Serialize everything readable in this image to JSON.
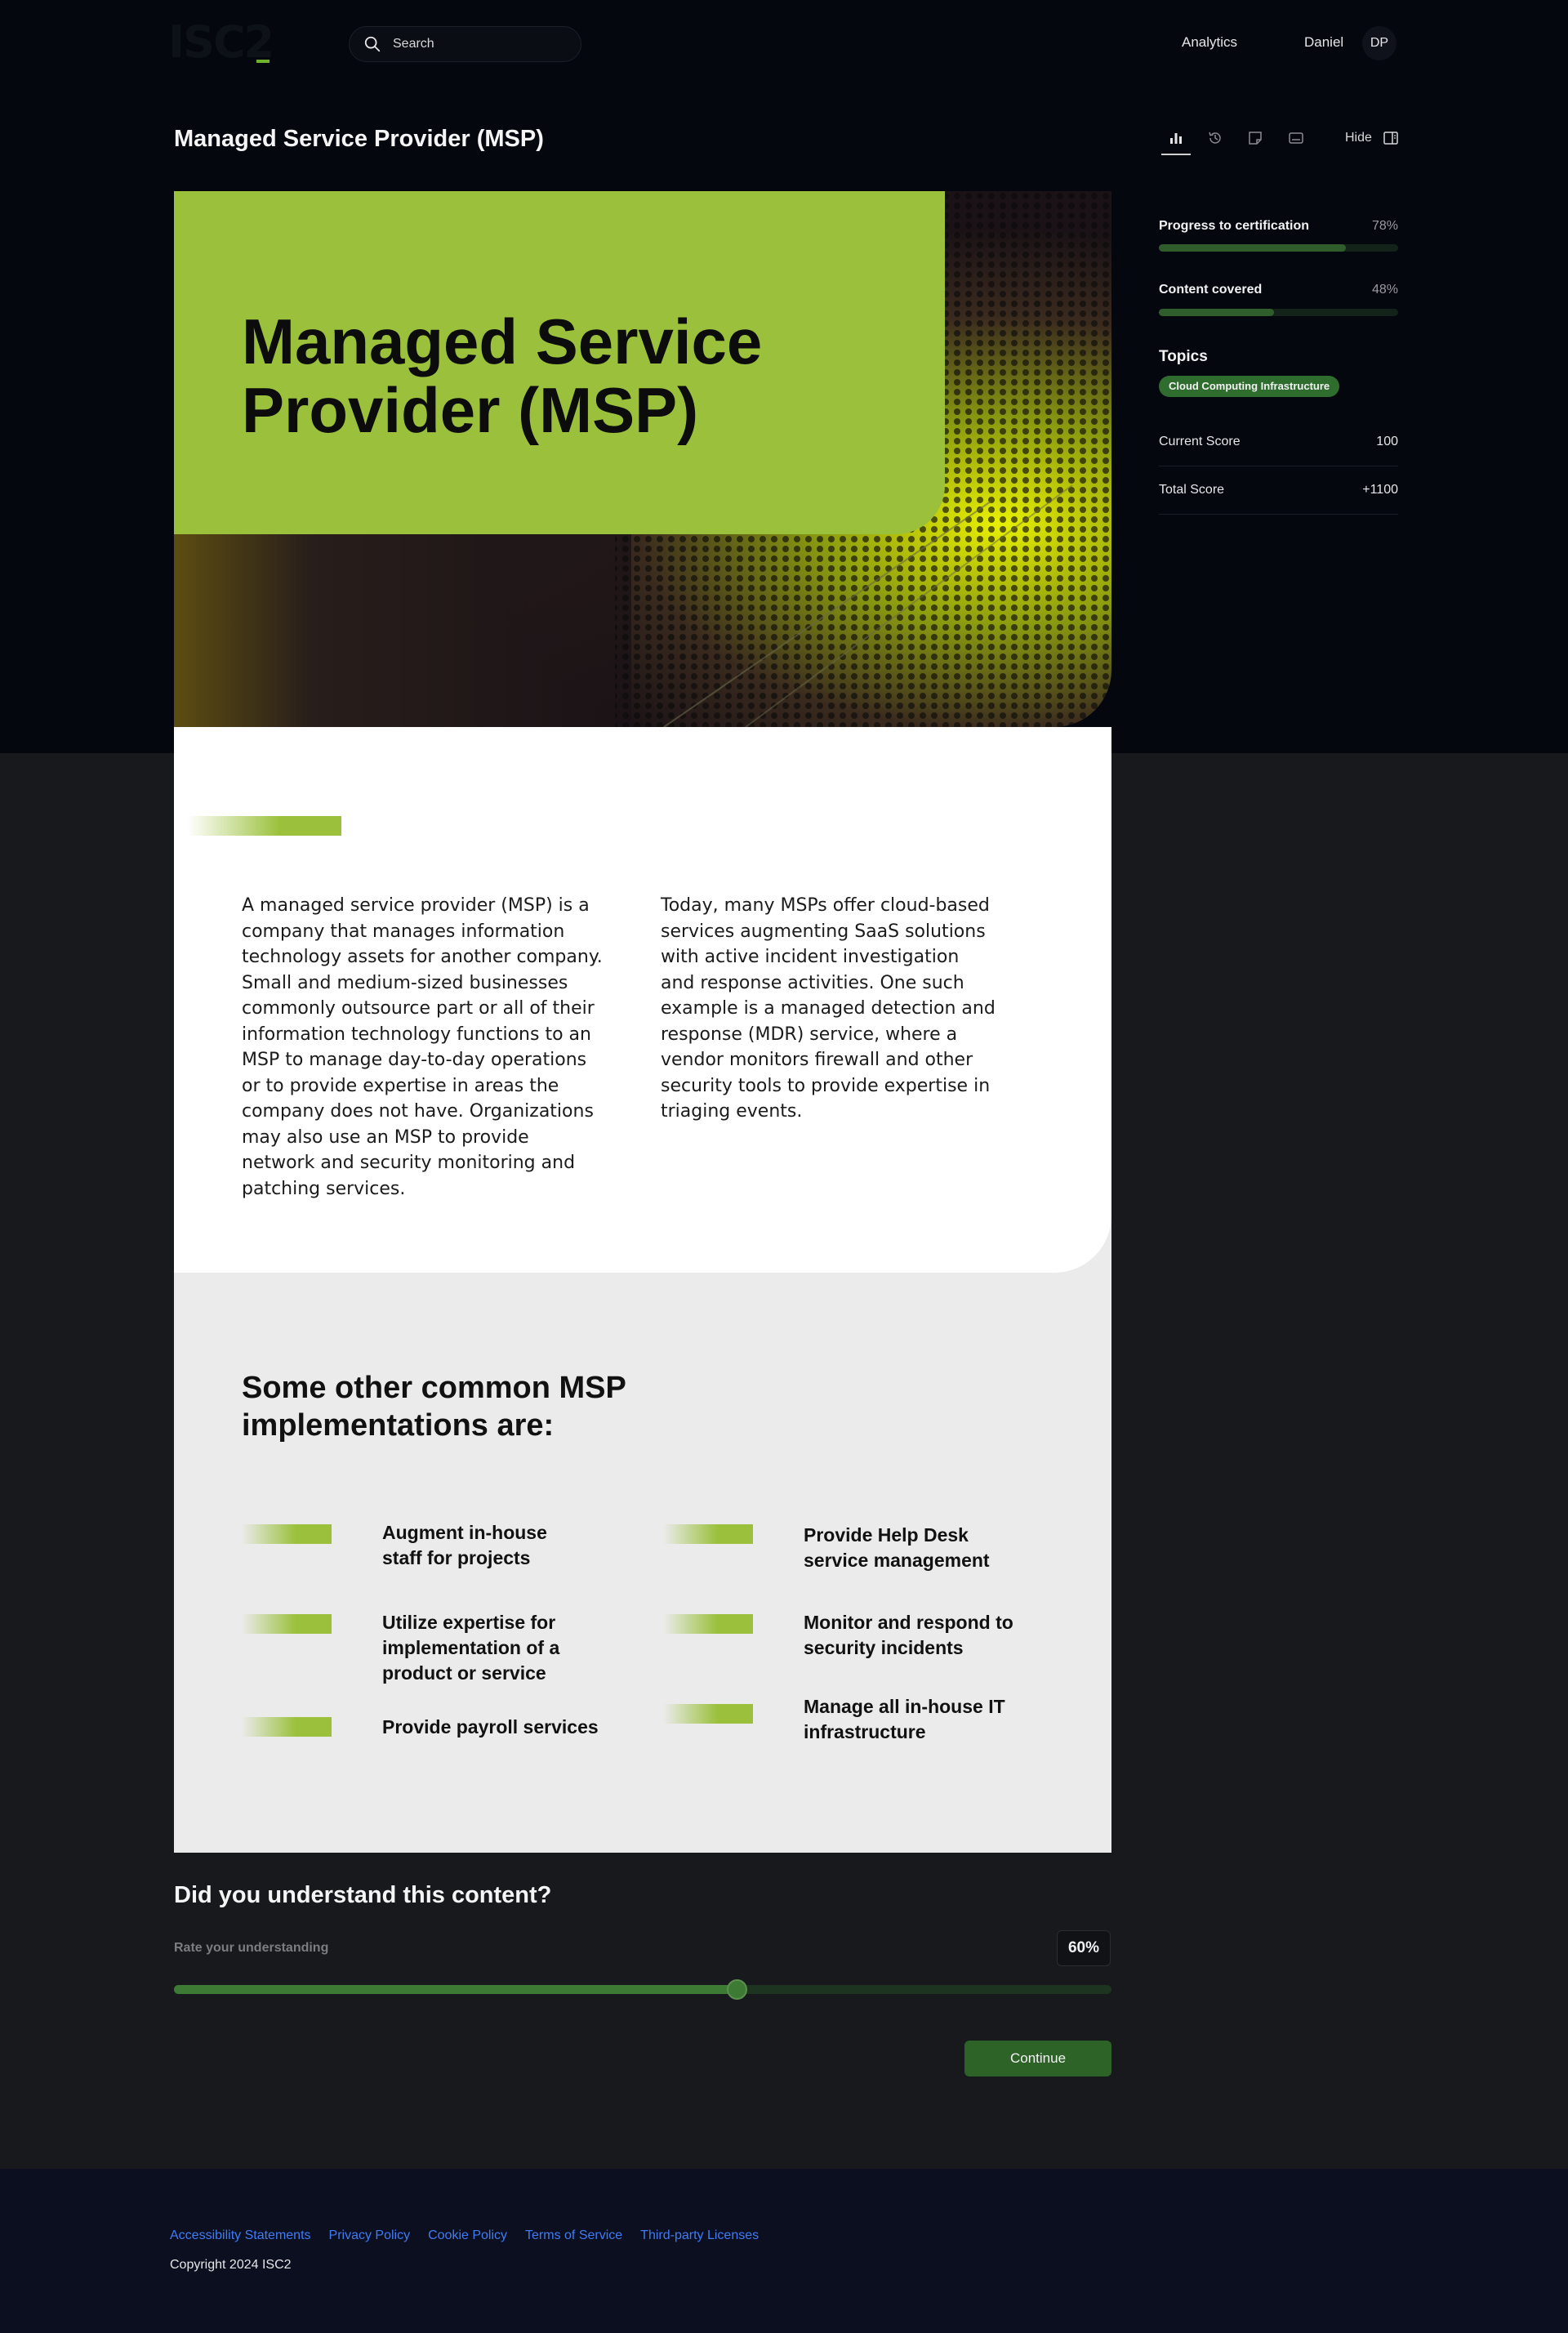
{
  "header": {
    "logo": "ISC2",
    "search_placeholder": "Search",
    "nav_analytics": "Analytics",
    "user_name": "Daniel",
    "avatar_initials": "DP"
  },
  "page_title": "Managed Service Provider (MSP)",
  "panel": {
    "hide_label": "Hide",
    "progress_label": "Progress to certification",
    "progress_pct": "78%",
    "progress_value": 0.78,
    "content_label": "Content covered",
    "content_pct": "48%",
    "content_value": 0.48,
    "topics_title": "Topics",
    "topic_chip": "Cloud Computing Infrastructure",
    "current_score_label": "Current Score",
    "current_score": "100",
    "total_score_label": "Total Score",
    "total_score": "+1100"
  },
  "content": {
    "hero_title": "Managed Service Provider (MSP)",
    "para_left": "A managed service provider (MSP) is a company that manages information technology assets for another company. Small and medium-sized businesses commonly outsource part or all of their information technology functions to an MSP to manage day-to-day operations or to provide expertise in areas the company does not have. Organizations may also use an MSP to provide network and security monitoring and patching services.",
    "para_right": "Today, many MSPs offer cloud-based services augmenting SaaS solutions with active incident investigation and response activities. One such example is a managed detection and response (MDR) service, where a vendor monitors firewall and other security tools to provide expertise in triaging events.",
    "section_heading": "Some other common MSP implementations are:",
    "implementations": [
      "Augment in-house staff for projects",
      "Utilize expertise for implementation of a product or service",
      "Provide payroll services",
      "Provide Help Desk service management",
      "Monitor and respond to security incidents",
      "Manage all in-house IT infrastructure"
    ]
  },
  "feedback": {
    "question": "Did you understand this content?",
    "rate_label": "Rate your understanding",
    "value_display": "60%",
    "value": 0.6,
    "continue_label": "Continue"
  },
  "footer": {
    "links": [
      "Accessibility Statements",
      "Privacy Policy",
      "Cookie Policy",
      "Terms of Service",
      "Third-party Licenses"
    ],
    "copyright": "Copyright 2024 ISC2"
  },
  "colors": {
    "accent_green": "#9bc13c",
    "dark_green": "#2f6d2f",
    "link_blue": "#3f7cf4"
  }
}
